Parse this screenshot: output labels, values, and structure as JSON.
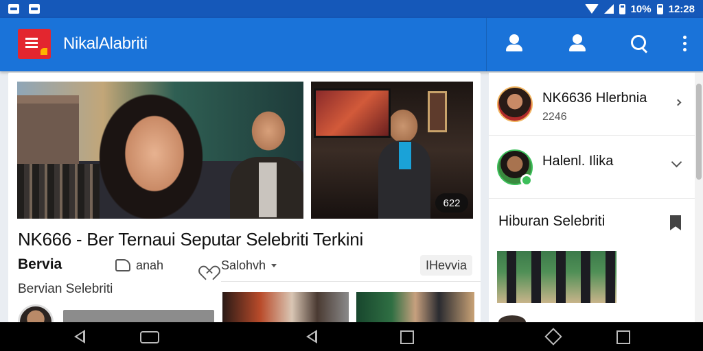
{
  "status_bar": {
    "battery_percent": "10%",
    "time": "12:28"
  },
  "app_bar": {
    "title": "NikalAlabriti"
  },
  "main": {
    "stage_badge": "622",
    "headline": "NK666 - Ber Ternaui Seputar Selebriti Terkini",
    "meta_label": "Bervia",
    "share_text": "anah",
    "like_text": "Salohvh",
    "chip_text": "IHevvia",
    "sub_label": "Bervian Selebriti"
  },
  "sidebar": {
    "items": [
      {
        "name": "NK6636 Hlerbnia",
        "sub": "2246"
      },
      {
        "name": "Halenl. Ilika"
      }
    ],
    "section_title": "Hiburan Selebriti"
  },
  "colors": {
    "status_bar": "#1558b9",
    "app_bar": "#1a73d9",
    "logo": "#e3262f",
    "online": "#3cbf5a"
  }
}
